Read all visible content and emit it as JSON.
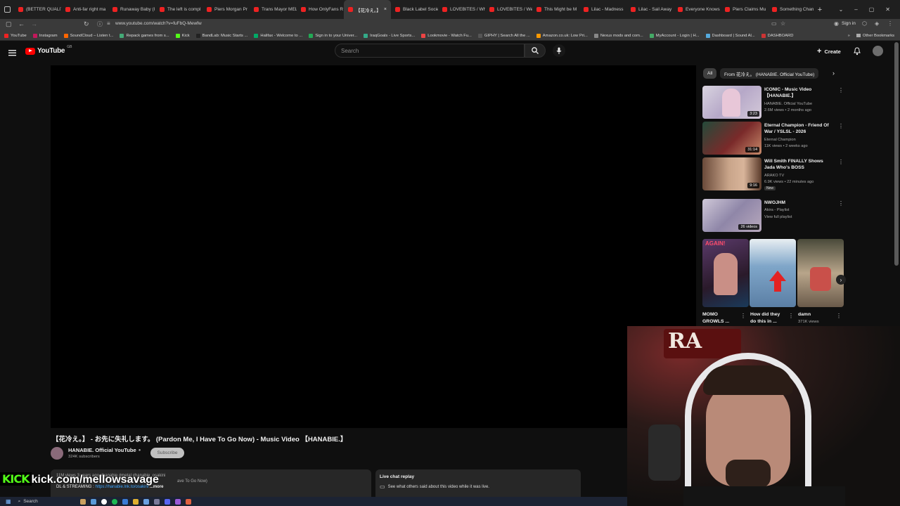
{
  "browser": {
    "tabs": [
      "(BETTER QUALIT",
      "Anti-far right ma",
      "Runaway Baby (l",
      "The left is compl",
      "Piers Morgan Pr",
      "Trans Mayor MEL",
      "How OnlyFans R",
      "【花冷え。】",
      "Black Label Socie",
      "LOVEBITES / Wh",
      "LOVEBITES / We",
      "This Might be M",
      "Lilac - Madness",
      "Lilac - Sail Away",
      "Everyone Knows",
      "Piers Claims Mu",
      "Something Chan"
    ],
    "active_tab_index": 7,
    "url": "www.youtube.com/watch?v=fuFbQ-Mewfw",
    "sign_in": "Sign in",
    "bookmarks": [
      "YouTube",
      "Instagram",
      "SoundCloud – Listen t...",
      "Repack games from s...",
      "Kick",
      "BandLab: Music Starts ...",
      "Halifax - Welcome to ...",
      "Sign in to your Univer...",
      "IraqGoals - Live Sports...",
      "Lookmovie - Watch Fu...",
      "GIPHY | Search All the ...",
      "Amazon.co.uk: Low Pri...",
      "Nexus mods and com...",
      "MyAccount - Login | H...",
      "Dashboard | Sound Al...",
      "DASHBOARD"
    ],
    "other_bookmarks": "Other Bookmarks"
  },
  "youtube": {
    "logo_text": "YouTube",
    "region": "GB",
    "search_placeholder": "Search",
    "create_label": "Create",
    "video": {
      "title": "【花冷え。】 - お先に失礼します。 (Pardon Me, I Have To Go Now) - Music Video 【HANABIE.】",
      "channel": "HANABIE. Official YouTube",
      "subscribers": "324K subscribers",
      "subscribe_label": "Subscribe",
      "desc_line1": "11M views  3 years ago  #hanabie #metal #hanabie_osakini",
      "desc_line2": "ave To Go Now)",
      "desc_line3_prefix": "DL & STREAMING : ",
      "desc_link": "https://hanabie.lnk.to/osakini",
      "desc_more": "...more"
    },
    "live_chat": {
      "title": "Live chat replay",
      "subtitle": "See what others said about this video while it was live."
    },
    "chips": [
      "All",
      "From 花冷え。 (HANABIE. Official YouTube)"
    ],
    "recommendations": [
      {
        "title": "ICONIC - Music Video 【HANABIE.】",
        "channel": "HANABIE. Official YouTube",
        "meta": "2.6M views • 2 months ago",
        "duration": "3:23",
        "badge": ""
      },
      {
        "title": "Eternal Champion - Friend Of War / YSLSL - 2026",
        "channel": "Eternal Champion",
        "meta": "11K views • 2 weeks ago",
        "duration": "31:14",
        "badge": ""
      },
      {
        "title": "Will Smith FINALLY Shows Jada Who's BOSS",
        "channel": "ARAKO TV",
        "meta": "6.9K views • 22 minutes ago",
        "duration": "9:16",
        "badge": "New"
      },
      {
        "title": "NWOJHM",
        "channel": "Akira - Playlist",
        "meta": "View full playlist",
        "duration": "26 videos",
        "badge": ""
      }
    ],
    "shorts": [
      {
        "title": "MOMO GROWLS ...",
        "views": "",
        "thumb_text": "AGAIN!"
      },
      {
        "title": "How did they do this in ...",
        "views": "",
        "thumb_text": ""
      },
      {
        "title": "damn",
        "views": "371K views",
        "thumb_text": ""
      }
    ]
  },
  "overlay": {
    "kick_logo": "KICK",
    "kick_url": "kick.com/mellowsavage"
  },
  "taskbar": {
    "search_label": "Search"
  },
  "colors": {
    "yt_red": "#ff0000",
    "kick_green": "#53fc18",
    "page_bg": "#0f0f0f"
  }
}
